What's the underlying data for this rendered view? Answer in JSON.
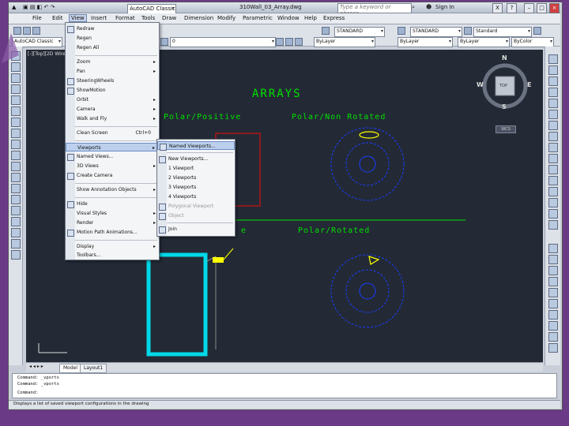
{
  "window": {
    "workspace": "AutoCAD Classic",
    "title": "310Wall_03_Array.dwg",
    "search_placeholder": "Type a keyword or phrase",
    "user": "Sign In",
    "btn_close": "X",
    "btn_help": "?"
  },
  "menubar": [
    "File",
    "Edit",
    "View",
    "Insert",
    "Format",
    "Tools",
    "Draw",
    "Dimension",
    "Modify",
    "Parametric",
    "Window",
    "Help",
    "Express"
  ],
  "menubar_active": "View",
  "toolbar": {
    "workspace_combo": "AutoCAD Classic",
    "layer_combo": "0",
    "linetype_combo": "ByLayer",
    "lineweight_combo": "ByLayer",
    "plotstyle_combo": "ByColor",
    "textstyle_combo": "STANDARD",
    "dimstyle_combo": "STANDARD",
    "tablestyle_combo": "Standard",
    "color_combo": "ByLayer"
  },
  "viewport_label": "[-][Top][2D Wireframe]",
  "view_menu": {
    "items": [
      {
        "label": "Redraw",
        "arrow": false
      },
      {
        "label": "Regen",
        "arrow": false
      },
      {
        "label": "Regen All",
        "arrow": false
      },
      {
        "label": "Zoom",
        "arrow": true
      },
      {
        "label": "Pan",
        "arrow": true
      },
      {
        "label": "SteeringWheels",
        "arrow": false
      },
      {
        "label": "ShowMotion",
        "arrow": false
      },
      {
        "label": "Orbit",
        "arrow": true
      },
      {
        "label": "Camera",
        "arrow": true
      },
      {
        "label": "Walk and Fly",
        "arrow": true
      },
      {
        "label": "Clean Screen",
        "shortcut": "Ctrl+0"
      },
      {
        "label": "Viewports",
        "arrow": true,
        "highlight": true
      },
      {
        "label": "Named Views...",
        "arrow": false
      },
      {
        "label": "3D Views",
        "arrow": true
      },
      {
        "label": "Create Camera",
        "arrow": false
      },
      {
        "label": "Show Annotation Objects",
        "arrow": true
      },
      {
        "label": "Hide",
        "arrow": false
      },
      {
        "label": "Visual Styles",
        "arrow": true
      },
      {
        "label": "Render",
        "arrow": true
      },
      {
        "label": "Motion Path Animations...",
        "arrow": false
      },
      {
        "label": "Display",
        "arrow": true
      },
      {
        "label": "Toolbars...",
        "arrow": false
      }
    ]
  },
  "viewports_menu": {
    "items": [
      {
        "label": "Named Viewports...",
        "highlight": true
      },
      {
        "label": "New Viewports..."
      },
      {
        "label": "1 Viewport"
      },
      {
        "label": "2 Viewports"
      },
      {
        "label": "3 Viewports"
      },
      {
        "label": "4 Viewports"
      },
      {
        "label": "Polygonal Viewport",
        "disabled": true
      },
      {
        "label": "Object",
        "disabled": true
      },
      {
        "label": "Join"
      }
    ]
  },
  "drawing": {
    "title": "ARRAYS",
    "labels": [
      "Polar/Positive",
      "Polar/Non Rotated",
      "Polar/Rotated"
    ],
    "partial_label": "e",
    "colors": {
      "title": "#00e000",
      "labels": "#00e000",
      "circles": "#1a3cff",
      "red": "#d01010",
      "cyan": "#00d8e8",
      "yellow": "#ffff00"
    }
  },
  "viewcube": {
    "north": "N",
    "south": "S",
    "east": "E",
    "west": "W",
    "face": "TOP",
    "wcs": "WCS"
  },
  "layout_tabs": [
    "Model",
    "Layout1"
  ],
  "command_lines": [
    "Command: _vports",
    "Command: _vports",
    "Command:"
  ],
  "status_text": "Displays a list of saved viewport configurations in the drawing"
}
